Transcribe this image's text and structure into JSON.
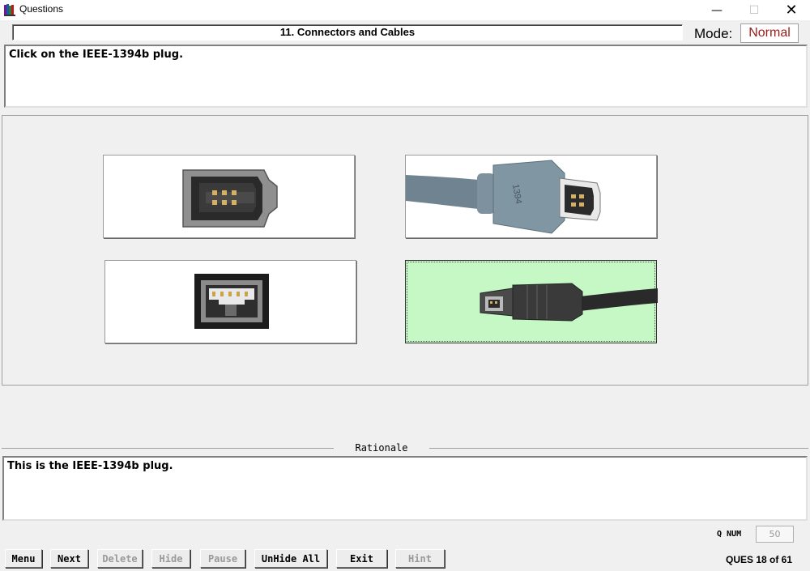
{
  "window": {
    "title": "Questions"
  },
  "header": {
    "section_title": "11. Connectors and Cables",
    "mode_label": "Mode:",
    "mode_value": "Normal",
    "mode_color": "#9b1b1b"
  },
  "question": {
    "text": "Click on the IEEE-1394b plug."
  },
  "choices": [
    {
      "id": 1,
      "image": "firewire-400-socket-6pin",
      "selected": false
    },
    {
      "id": 2,
      "image": "firewire-6pin-plug-cable",
      "selected": false
    },
    {
      "id": 3,
      "image": "firewire-800-socket-9pin",
      "selected": false
    },
    {
      "id": 4,
      "image": "firewire-4pin-plug-cable",
      "selected": true,
      "highlight_color": "#c6f8c6"
    }
  ],
  "rationale": {
    "label": "Rationale",
    "text": "This is the IEEE-1394b plug."
  },
  "status": {
    "qnum_label": "Q NUM",
    "qnum_value": "50",
    "ques_count": "QUES 18 of 61"
  },
  "buttons": [
    {
      "key": "menu",
      "label": "Menu",
      "enabled": true
    },
    {
      "key": "next",
      "label": "Next",
      "enabled": true
    },
    {
      "key": "delete",
      "label": "Delete",
      "enabled": false
    },
    {
      "key": "hide",
      "label": "Hide",
      "enabled": false
    },
    {
      "key": "pause",
      "label": "Pause",
      "enabled": false
    },
    {
      "key": "unhide",
      "label": "UnHide All",
      "enabled": true
    },
    {
      "key": "exit",
      "label": "Exit",
      "enabled": true
    },
    {
      "key": "hint",
      "label": "Hint",
      "enabled": false
    }
  ]
}
